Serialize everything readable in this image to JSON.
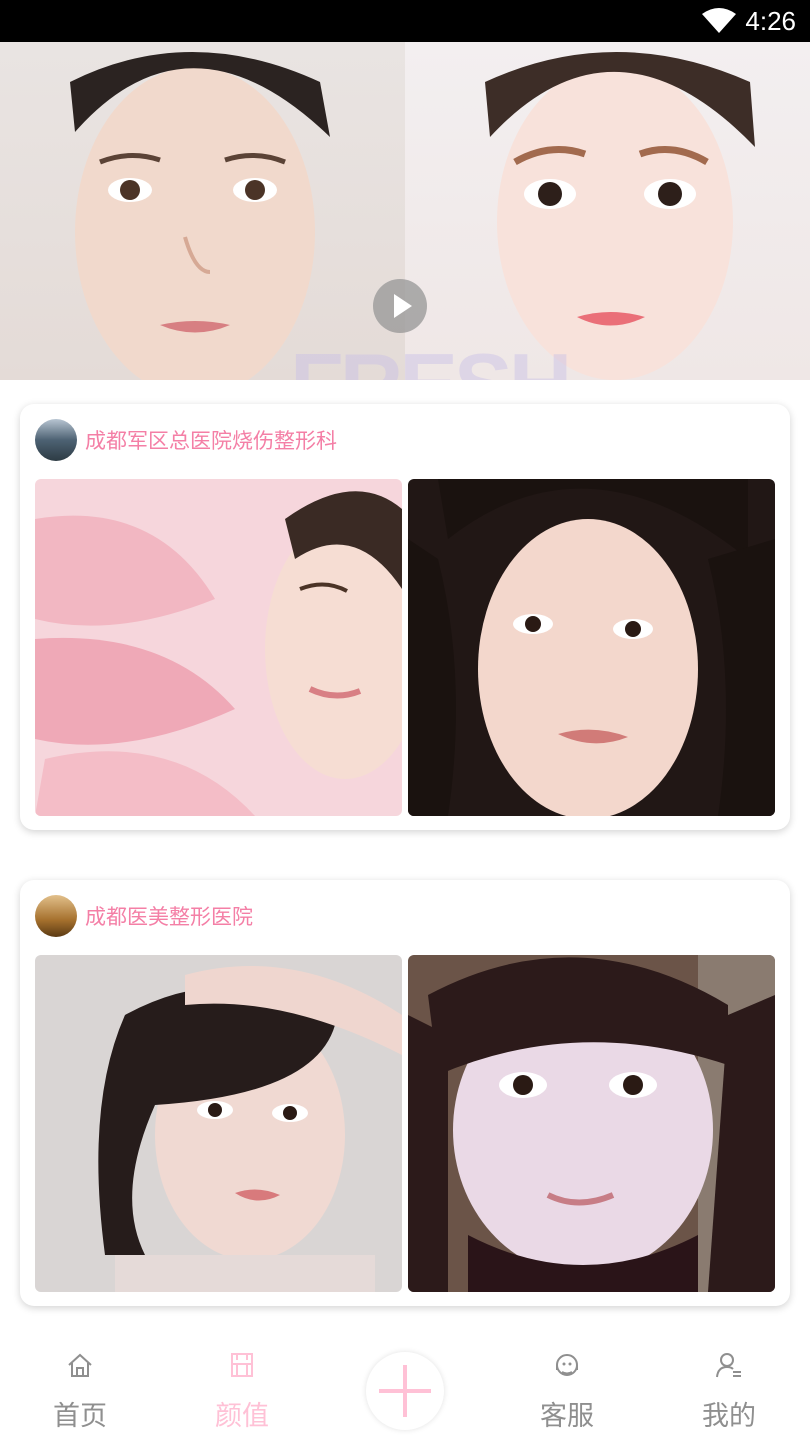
{
  "status_bar": {
    "time": "4:26",
    "wifi_icon": "wifi-icon"
  },
  "banner": {
    "brand_mark": "FRESH",
    "play_icon": "play-icon"
  },
  "cards": [
    {
      "hospital_name": "成都军区总医院烧伤整形科",
      "avatar_icon": "hospital-avatar"
    },
    {
      "hospital_name": "成都医美整形医院",
      "avatar_icon": "hospital-avatar"
    }
  ],
  "tabbar": {
    "accent_color": "#ffc1d6",
    "inactive_color": "#8f8f8f",
    "tabs": [
      {
        "label": "首页",
        "icon": "home-icon",
        "active": false
      },
      {
        "label": "颜值",
        "icon": "beauty-icon",
        "active": true
      },
      {
        "label": "客服",
        "icon": "customer-service-icon",
        "active": false
      },
      {
        "label": "我的",
        "icon": "profile-icon",
        "active": false
      }
    ],
    "add_icon": "plus-icon"
  }
}
